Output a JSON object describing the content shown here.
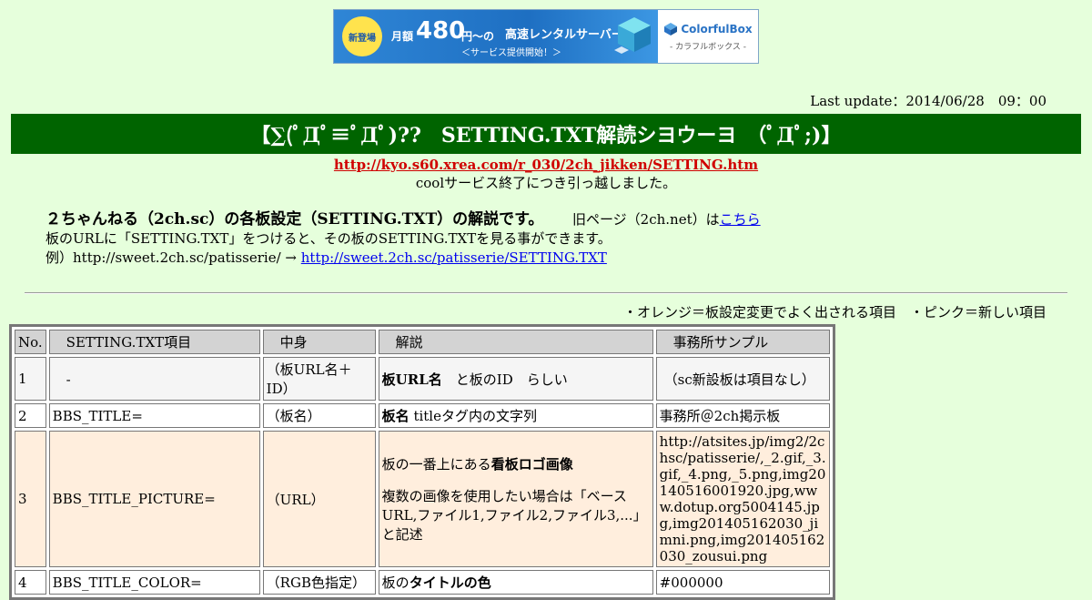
{
  "banner": {
    "badge": "新登場",
    "monthly": "月額",
    "price": "480",
    "unit": "円～の",
    "product": "高速レンタルサーバー",
    "sub": "＜サービス提供開始！＞",
    "brand": "ColorfulBox",
    "brand_sub": "- カラフルボックス -",
    "brand_color": "#2a73c5"
  },
  "last_update": "Last update：2014/06/28　09：00",
  "title": "【∑(ﾟДﾟ≡ﾟДﾟ)??　SETTING.TXT解読シヨウーヨ　（ﾟДﾟ;)】",
  "move": {
    "url": "http://kyo.s60.xrea.com/r_030/2ch_jikken/SETTING.htm",
    "note": "coolサービス終了につき引っ越しました。"
  },
  "description": {
    "heading": "２ちゃんねる（2ch.sc）の各板設定（SETTING.TXT）の解説です。",
    "old_page_prefix": "旧ページ（2ch.net）は",
    "old_page_link": "こちら",
    "line2": "板のURLに「SETTING.TXT」をつけると、その板のSETTING.TXTを見る事ができます。",
    "line3_prefix": "例）http://sweet.2ch.sc/patisserie/ →",
    "line3_link": "http://sweet.2ch.sc/patisserie/SETTING.TXT"
  },
  "legend": "・オレンジ＝板設定変更でよく出される項目　・ピンク＝新しい項目",
  "table": {
    "headers": [
      "No.",
      "　SETTING.TXT項目",
      "　中身",
      "　解説",
      "　事務所サンプル"
    ],
    "rows": [
      {
        "no": "1",
        "item": "　-",
        "value": "（板URL名＋ID）",
        "explain_bold": "板URL名",
        "explain_rest": "　と板のID　らしい",
        "sample": "（sc新設板は項目なし）"
      },
      {
        "no": "2",
        "item": "BBS_TITLE=",
        "value": "（板名）",
        "explain_bold": "板名",
        "explain_rest": " titleタグ内の文字列",
        "sample": "事務所＠2ch掲示板"
      },
      {
        "no": "3",
        "item": "BBS_TITLE_PICTURE=",
        "value": "（URL）",
        "explain_pre": "板の一番上にある",
        "explain_bold": "看板ロゴ画像",
        "explain_note": "複数の画像を使用したい場合は「ベースURL,ファイル1,ファイル2,ファイル3,...」と記述",
        "sample": "http://atsites.jp/img2/2chsc/patisserie/,_2.gif,_3.gif,_4.png,_5.png,img20140516001920.jpg,www.dotup.org5004145.jpg,img201405162030_jimni.png,img201405162030_zousui.png"
      },
      {
        "no": "4",
        "item": "BBS_TITLE_COLOR=",
        "value": "（RGB色指定）",
        "explain_pre": "板の",
        "explain_bold": "タイトルの色",
        "sample": "#000000"
      }
    ]
  },
  "colors": {
    "background": "#e6ffdc",
    "title_bar": "#006400",
    "orange_row": "#ffeedd",
    "move_link": "#d00000"
  }
}
